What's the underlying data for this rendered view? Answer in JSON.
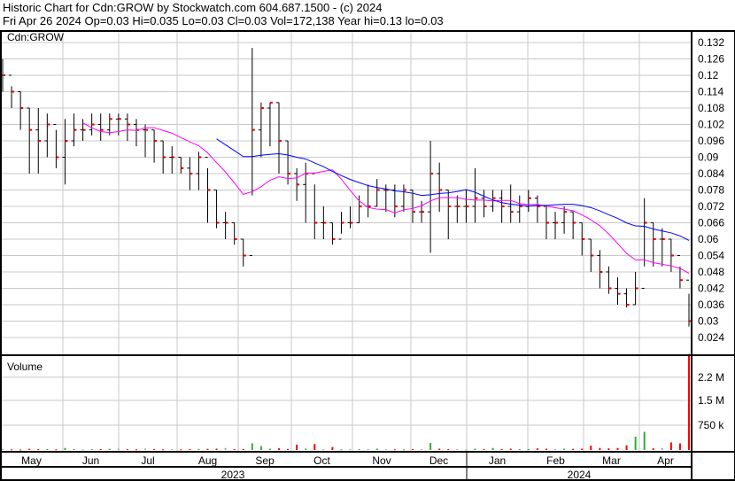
{
  "header": {
    "title": "Historic Chart for Cdn:GROW by Stockwatch.com 604.687.1500 - (c) 2024",
    "quote": "Fri Apr 26 2024   Op=0.03  Hi=0.035  Lo=0.03  Cl=0.03  Vol=172,138  Year hi=0.13  lo=0.03"
  },
  "colors": {
    "down": "#ff0000",
    "up": "#33aa33",
    "flat": "#aaaaaa",
    "ma_short": "#ff00ff",
    "ma_long": "#0000ff",
    "grid": "#c8c8c8"
  },
  "chart_data": {
    "type": "ohlc",
    "symbol_label": "Cdn:GROW",
    "volume_label": "Volume",
    "price_ticks": [
      "0.132",
      "0.126",
      "0.12",
      "0.114",
      "0.108",
      "0.102",
      "0.096",
      "0.09",
      "0.084",
      "0.078",
      "0.072",
      "0.066",
      "0.06",
      "0.054",
      "0.048",
      "0.042",
      "0.036",
      "0.03",
      "0.024"
    ],
    "price_range": [
      0.021,
      0.135
    ],
    "volume_ticks": [
      {
        "label": "2.2 M",
        "value": 2200
      },
      {
        "label": "1.5 M",
        "value": 1500
      },
      {
        "label": "750 k",
        "value": 750
      }
    ],
    "volume_unit": "thousands",
    "months": [
      "May",
      "Jun",
      "Jul",
      "Aug",
      "Sep",
      "Oct",
      "Nov",
      "Dec",
      "Jan",
      "Feb",
      "Mar",
      "Apr"
    ],
    "years": [
      "2023",
      "2024"
    ],
    "close": [
      0.12,
      0.114,
      0.108,
      0.1,
      0.096,
      0.102,
      0.09,
      0.096,
      0.1,
      0.1,
      0.102,
      0.1,
      0.104,
      0.104,
      0.102,
      0.1,
      0.1,
      0.096,
      0.09,
      0.09,
      0.086,
      0.084,
      0.09,
      0.078,
      0.066,
      0.066,
      0.06,
      0.054,
      0.1,
      0.108,
      0.11,
      0.096,
      0.084,
      0.08,
      0.084,
      0.066,
      0.066,
      0.06,
      0.066,
      0.066,
      0.072,
      0.072,
      0.078,
      0.078,
      0.072,
      0.078,
      0.07,
      0.07,
      0.084,
      0.078,
      0.072,
      0.072,
      0.072,
      0.075,
      0.072,
      0.075,
      0.072,
      0.07,
      0.072,
      0.075,
      0.072,
      0.066,
      0.066,
      0.07,
      0.066,
      0.06,
      0.054,
      0.048,
      0.042,
      0.04,
      0.036,
      0.042,
      0.066,
      0.06,
      0.06,
      0.054,
      0.045,
      0.03
    ],
    "high": [
      0.126,
      0.116,
      0.114,
      0.108,
      0.108,
      0.106,
      0.1,
      0.104,
      0.106,
      0.104,
      0.106,
      0.106,
      0.106,
      0.106,
      0.106,
      0.104,
      0.102,
      0.1,
      0.096,
      0.094,
      0.09,
      0.09,
      0.092,
      0.086,
      0.078,
      0.07,
      0.066,
      0.06,
      0.13,
      0.11,
      0.11,
      0.11,
      0.096,
      0.086,
      0.088,
      0.08,
      0.072,
      0.066,
      0.07,
      0.072,
      0.076,
      0.08,
      0.082,
      0.08,
      0.08,
      0.08,
      0.078,
      0.074,
      0.096,
      0.088,
      0.078,
      0.076,
      0.078,
      0.086,
      0.078,
      0.078,
      0.078,
      0.08,
      0.076,
      0.078,
      0.076,
      0.072,
      0.07,
      0.072,
      0.07,
      0.066,
      0.06,
      0.056,
      0.05,
      0.046,
      0.042,
      0.048,
      0.075,
      0.066,
      0.064,
      0.06,
      0.05,
      0.04
    ],
    "low": [
      0.114,
      0.108,
      0.1,
      0.084,
      0.084,
      0.09,
      0.086,
      0.08,
      0.094,
      0.096,
      0.098,
      0.096,
      0.098,
      0.098,
      0.096,
      0.094,
      0.09,
      0.088,
      0.084,
      0.084,
      0.084,
      0.078,
      0.078,
      0.066,
      0.064,
      0.06,
      0.058,
      0.05,
      0.076,
      0.09,
      0.094,
      0.084,
      0.08,
      0.074,
      0.066,
      0.06,
      0.06,
      0.058,
      0.062,
      0.064,
      0.066,
      0.068,
      0.072,
      0.07,
      0.068,
      0.07,
      0.066,
      0.066,
      0.055,
      0.07,
      0.06,
      0.066,
      0.066,
      0.066,
      0.068,
      0.07,
      0.066,
      0.066,
      0.066,
      0.07,
      0.066,
      0.06,
      0.06,
      0.062,
      0.06,
      0.054,
      0.048,
      0.042,
      0.04,
      0.036,
      0.035,
      0.036,
      0.05,
      0.05,
      0.05,
      0.048,
      0.042,
      0.028
    ],
    "volume": [
      30,
      20,
      15,
      35,
      25,
      30,
      20,
      60,
      25,
      20,
      25,
      30,
      35,
      40,
      25,
      20,
      45,
      30,
      20,
      30,
      20,
      25,
      30,
      35,
      40,
      60,
      25,
      30,
      200,
      120,
      40,
      50,
      30,
      160,
      40,
      180,
      25,
      90,
      20,
      30,
      25,
      30,
      40,
      25,
      20,
      20,
      30,
      25,
      210,
      40,
      25,
      30,
      20,
      40,
      30,
      60,
      30,
      40,
      25,
      30,
      50,
      40,
      30,
      40,
      35,
      40,
      130,
      60,
      50,
      60,
      140,
      400,
      550,
      50,
      60,
      230,
      200,
      2900
    ],
    "ma_short_period": 10,
    "ma_long_period": 25
  }
}
